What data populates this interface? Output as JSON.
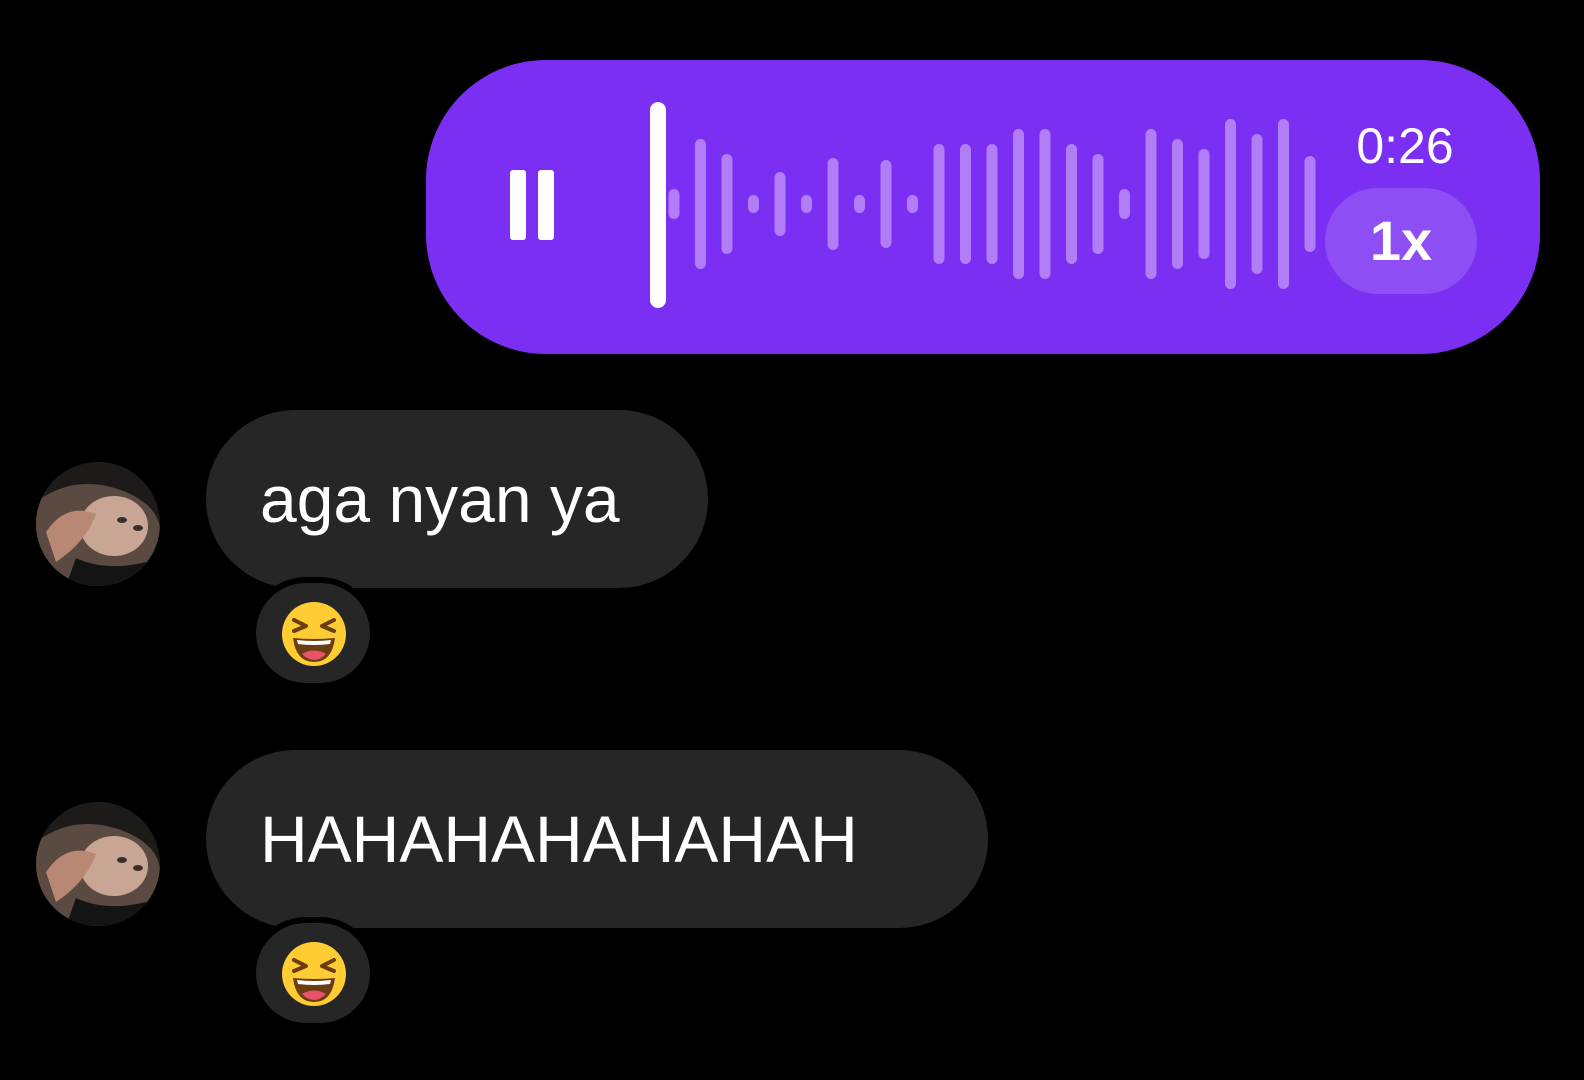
{
  "voice_message": {
    "duration": "0:26",
    "speed_label": "1x",
    "progress": 0.03,
    "play_state_icon": "pause-icon",
    "colors": {
      "bubble": "#7b2ff2",
      "played_bar": "#ffffff",
      "unplayed_bar": "#b27ef7",
      "speed_pill": "#8d4ff4"
    }
  },
  "messages": [
    {
      "text": "aga nyan ya",
      "reaction": "laughing-squinting-face",
      "avatar_icon": "contact-avatar"
    },
    {
      "text": "HAHAHAHAHAHAH",
      "reaction": "laughing-squinting-face",
      "avatar_icon": "contact-avatar"
    }
  ],
  "colors": {
    "background": "#000000",
    "incoming_bubble": "#262626",
    "text": "#ffffff"
  }
}
